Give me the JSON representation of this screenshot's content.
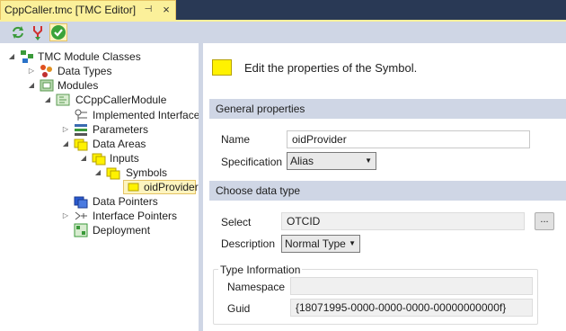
{
  "tab": {
    "title": "CppCaller.tmc [TMC Editor]",
    "pin_glyph": "⊣",
    "close_glyph": "×"
  },
  "toolbar": {
    "buttons": [
      "refresh-icon",
      "merge-icon",
      "check-icon"
    ]
  },
  "tree": {
    "items": [
      {
        "label": "TMC Module Classes",
        "icon": "tmc-classes-icon"
      },
      {
        "label": "Data Types",
        "icon": "data-types-icon"
      },
      {
        "label": "Modules",
        "icon": "modules-icon"
      },
      {
        "label": "CCppCallerModule",
        "icon": "module-icon"
      },
      {
        "label": "Implemented Interfaces",
        "icon": "interfaces-icon"
      },
      {
        "label": "Parameters",
        "icon": "parameters-icon"
      },
      {
        "label": "Data Areas",
        "icon": "folder-icon"
      },
      {
        "label": "Inputs",
        "icon": "folder-icon"
      },
      {
        "label": "Symbols",
        "icon": "folder-icon"
      },
      {
        "label": "oidProvider",
        "icon": "symbol-icon"
      },
      {
        "label": "Data Pointers",
        "icon": "data-pointers-icon"
      },
      {
        "label": "Interface Pointers",
        "icon": "interface-pointers-icon"
      },
      {
        "label": "Deployment",
        "icon": "deployment-icon"
      }
    ]
  },
  "editor": {
    "header": "Edit the properties of the Symbol.",
    "general": {
      "title": "General properties",
      "name_label": "Name",
      "name_value": "oidProvider",
      "spec_label": "Specification",
      "spec_value": "Alias"
    },
    "datatype": {
      "title": "Choose data type",
      "select_label": "Select",
      "select_value": "OTCID",
      "browse_label": "...",
      "desc_label": "Description",
      "desc_value": "Normal Type"
    },
    "typeinfo": {
      "title": "Type Information",
      "namespace_label": "Namespace",
      "namespace_value": "",
      "guid_label": "Guid",
      "guid_value": "{18071995-0000-0000-0000-00000000000f}"
    }
  },
  "colors": {
    "tab_active": "#fbf09a",
    "tab_strip": "#293955",
    "section_bg": "#cfd6e5",
    "selection": "#fdf4bf"
  }
}
